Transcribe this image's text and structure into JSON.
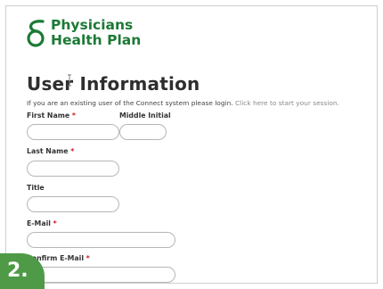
{
  "brand": {
    "line1": "Physicians",
    "line2": "Health Plan",
    "color": "#1c7a36",
    "logo_icon": "php-logo-icon"
  },
  "page": {
    "title": "User Information",
    "intro_text": "If you are an existing user of the Connect system please login.",
    "intro_link": "Click here to start your session."
  },
  "form": {
    "required_marker": "*",
    "first_name": {
      "label": "First Name",
      "value": ""
    },
    "middle_initial": {
      "label": "Middle Initial",
      "value": ""
    },
    "last_name": {
      "label": "Last Name",
      "value": ""
    },
    "title": {
      "label": "Title",
      "value": ""
    },
    "email": {
      "label": "E-Mail",
      "value": ""
    },
    "confirm_email": {
      "label": "Confirm E-Mail",
      "value": ""
    }
  },
  "step_badge": {
    "label": "2.",
    "color": "#4f9a47"
  }
}
